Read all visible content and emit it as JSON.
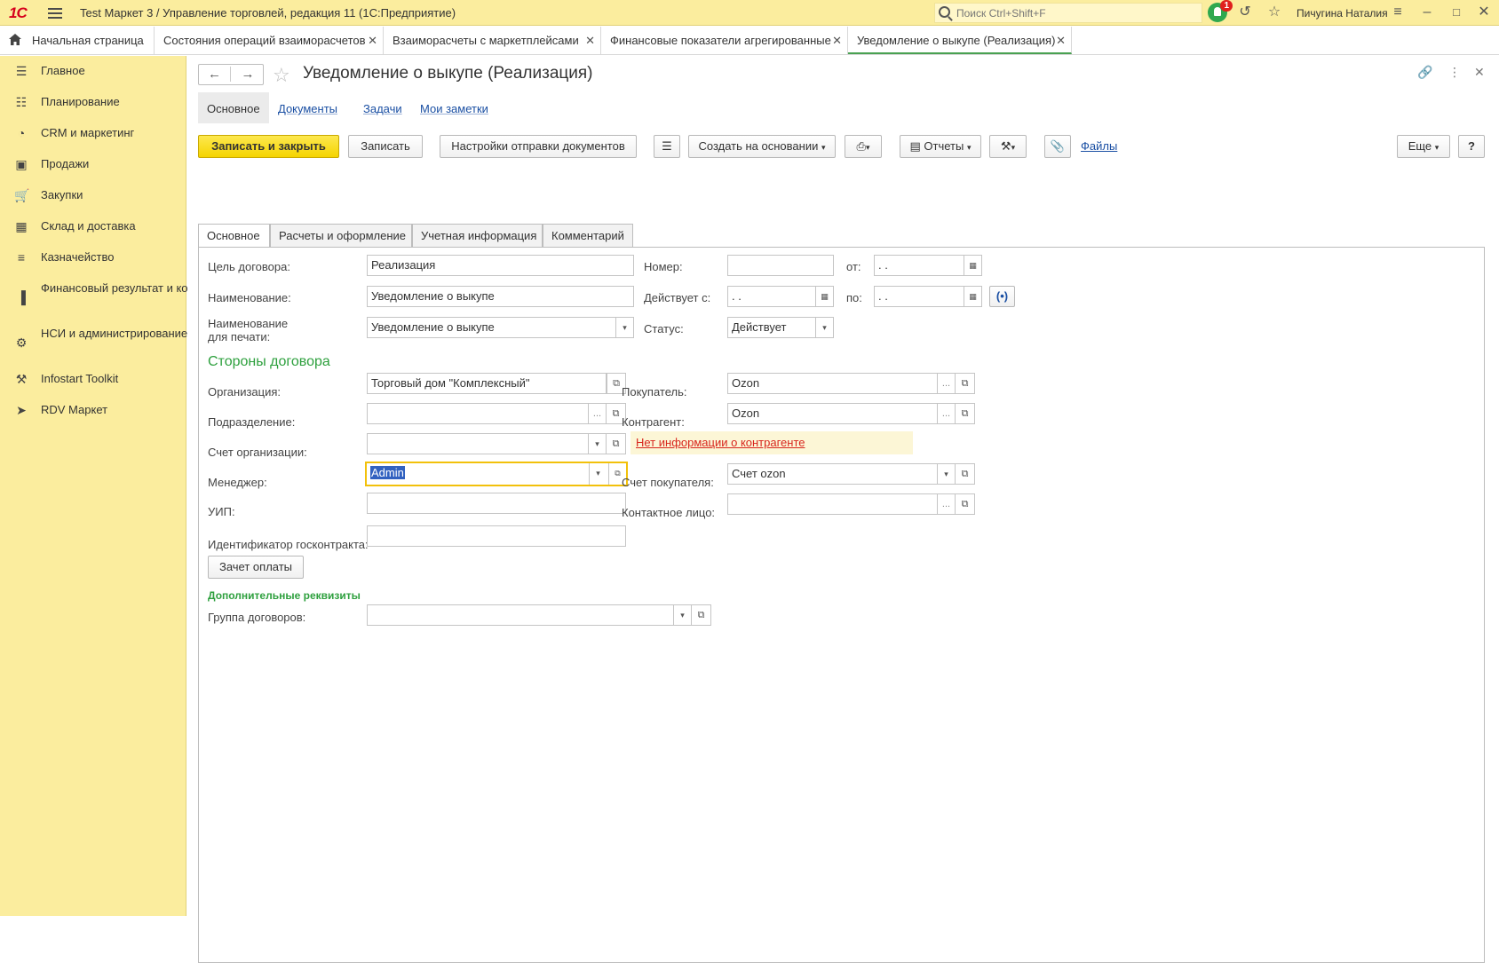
{
  "titlebar": {
    "logo": "1С",
    "app_title": "Test Маркет 3 / Управление торговлей, редакция 11  (1С:Предприятие)",
    "search_placeholder": "Поиск Ctrl+Shift+F",
    "notification_count": "1",
    "user_name": "Пичугина Наталия"
  },
  "tabs": [
    {
      "label": "Начальная страница"
    },
    {
      "label": "Состояния операций взаиморасчетов"
    },
    {
      "label": "Взаиморасчеты с маркетплейсами"
    },
    {
      "label": "Финансовые показатели агрегированные"
    },
    {
      "label": "Уведомление о выкупе (Реализация)"
    }
  ],
  "sidebar": {
    "items": [
      {
        "label": "Главное",
        "icon": "menu-icon"
      },
      {
        "label": "Планирование",
        "icon": "planning-icon"
      },
      {
        "label": "CRM и маркетинг",
        "icon": "pie-chart-icon"
      },
      {
        "label": "Продажи",
        "icon": "shopping-bag-icon"
      },
      {
        "label": "Закупки",
        "icon": "cart-icon"
      },
      {
        "label": "Склад и доставка",
        "icon": "warehouse-icon"
      },
      {
        "label": "Казначейство",
        "icon": "coins-icon"
      },
      {
        "label": "Финансовый результат и контроллинг",
        "icon": "bar-chart-icon"
      },
      {
        "label": "НСИ и администрирование",
        "icon": "gear-icon"
      },
      {
        "label": "Infostart Toolkit",
        "icon": "tools-icon"
      },
      {
        "label": "RDV Маркет",
        "icon": "rocket-icon"
      }
    ]
  },
  "form": {
    "title": "Уведомление о выкупе (Реализация)",
    "subnav": {
      "current": "Основное",
      "links": [
        "Документы",
        "Задачи",
        "Мои заметки"
      ]
    },
    "toolbar": {
      "save_close": "Записать и закрыть",
      "save": "Записать",
      "send_settings": "Настройки отправки документов",
      "create_based": "Создать на основании",
      "reports": "Отчеты",
      "files": "Файлы",
      "more": "Еще",
      "help": "?"
    },
    "form_tabs": [
      "Основное",
      "Расчеты и оформление",
      "Учетная информация",
      "Комментарий"
    ],
    "fields": {
      "purpose_label": "Цель договора:",
      "purpose_value": "Реализация",
      "name_label": "Наименование:",
      "name_value": "Уведомление о выкупе",
      "print_name_label_1": "Наименование",
      "print_name_label_2": "для печати:",
      "print_name_value": "Уведомление о выкупе",
      "number_label": "Номер:",
      "number_value": "",
      "from_label": "от:",
      "from_value": " .  .",
      "valid_from_label": "Действует с:",
      "valid_from_value": " .  .",
      "to_label": "по:",
      "to_value": " .  .",
      "status_label": "Статус:",
      "status_value": "Действует"
    },
    "parties": {
      "title": "Стороны договора",
      "org_label": "Организация:",
      "org_value": "Торговый дом \"Комплексный\"",
      "dept_label": "Подразделение:",
      "dept_value": "",
      "org_account_label": "Счет организации:",
      "org_account_value": "",
      "manager_label": "Менеджер:",
      "manager_value": "Admin",
      "uip_label": "УИП:",
      "uip_value": "",
      "gov_id_label": "Идентификатор госконтракта:",
      "gov_id_value": "",
      "buyer_label": "Покупатель:",
      "buyer_value": "Ozon",
      "counterparty_label": "Контрагент:",
      "counterparty_value": "Ozon",
      "no_info_link": "Нет информации о контрагенте",
      "buyer_account_label": "Счет покупателя:",
      "buyer_account_value": "Счет ozon",
      "contact_label": "Контактное лицо:",
      "contact_value": "",
      "offset_button": "Зачет оплаты"
    },
    "extra": {
      "title": "Дополнительные реквизиты",
      "group_label": "Группа договоров:",
      "group_value": ""
    }
  },
  "colors": {
    "sidebar_bg": "#fbed9e",
    "primary_button": "#f5d400",
    "section_green": "#2ea03e",
    "link_blue": "#1a4fa3",
    "warning_red": "#d8261d"
  }
}
